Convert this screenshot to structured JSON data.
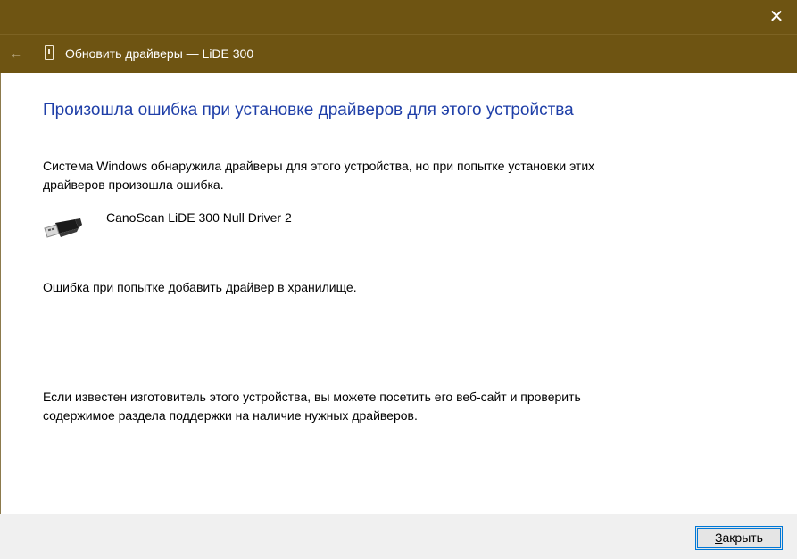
{
  "titlebar": {
    "close_glyph": "✕"
  },
  "nav": {
    "back_glyph": "←",
    "title": "Обновить драйверы — LiDE 300",
    "device_icon": "device-icon"
  },
  "content": {
    "heading": "Произошла ошибка при установке драйверов для этого устройства",
    "description": "Система Windows обнаружила драйверы для этого устройства, но при попытке установки этих драйверов произошла ошибка.",
    "driver": {
      "icon": "usb-icon",
      "name": "CanoScan LiDE 300 Null Driver 2"
    },
    "error_message": "Ошибка при попытке добавить драйвер в хранилище.",
    "advice": "Если известен изготовитель этого устройства, вы можете посетить его веб-сайт и проверить содержимое раздела поддержки на наличие нужных драйверов."
  },
  "footer": {
    "close_button": {
      "accel": "З",
      "rest": "акрыть"
    }
  },
  "colors": {
    "titlebar_bg": "#6e5412",
    "heading": "#1f3fa8",
    "footer_bg": "#f0f0f0",
    "button_focus": "#0078d7"
  }
}
